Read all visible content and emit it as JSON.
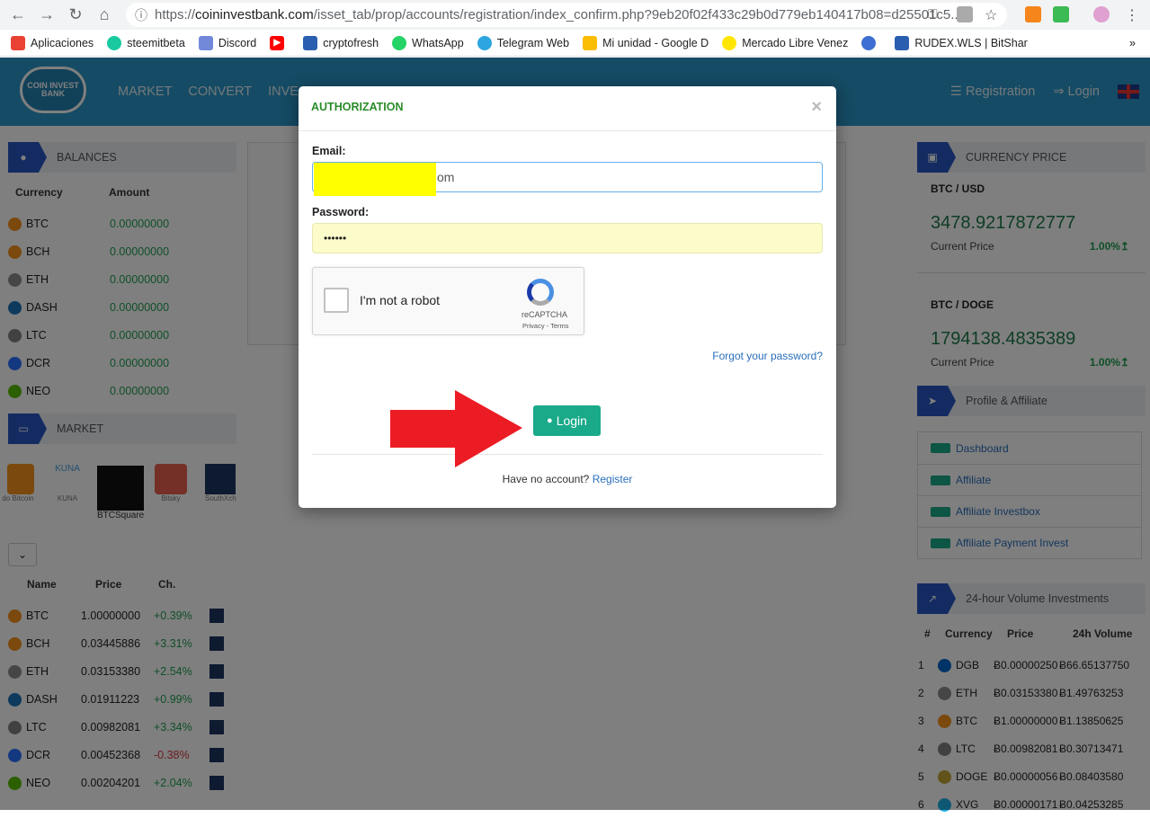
{
  "browser": {
    "url_prefix": "https://",
    "url_host": "coininvestbank.com",
    "url_path": "/isset_tab/prop/accounts/registration/index_confirm.php?9eb20f02f433c29b0d779eb140417b08=d25501c5...",
    "bookmarks": [
      "Aplicaciones",
      "steemitbeta",
      "Discord",
      "",
      "cryptofresh",
      "WhatsApp",
      "Telegram Web",
      "Mi unidad - Google D",
      "Mercado Libre Venez",
      "",
      "RUDEX.WLS | BitShar"
    ],
    "more": "»"
  },
  "header": {
    "logo_text": "COIN INVEST BANK",
    "nav": [
      "MARKET",
      "CONVERT",
      "INVE"
    ],
    "registration": "Registration",
    "login": "Login"
  },
  "balances": {
    "title": "BALANCES",
    "col_currency": "Currency",
    "col_amount": "Amount",
    "rows": [
      {
        "sym": "BTC",
        "amt": "0.00000000"
      },
      {
        "sym": "BCH",
        "amt": "0.00000000"
      },
      {
        "sym": "ETH",
        "amt": "0.00000000"
      },
      {
        "sym": "DASH",
        "amt": "0.00000000"
      },
      {
        "sym": "LTC",
        "amt": "0.00000000"
      },
      {
        "sym": "DCR",
        "amt": "0.00000000"
      },
      {
        "sym": "NEO",
        "amt": "0.00000000"
      }
    ]
  },
  "market": {
    "title": "MARKET",
    "logos": [
      "do Bitcoin",
      "KUNA",
      "BTCSquare",
      "Bitsky",
      "SouthXch"
    ],
    "col_name": "Name",
    "col_price": "Price",
    "col_ch": "Ch.",
    "rows": [
      {
        "sym": "BTC",
        "price": "1.00000000",
        "ch": "+0.39%",
        "up": true
      },
      {
        "sym": "BCH",
        "price": "0.03445886",
        "ch": "+3.31%",
        "up": true
      },
      {
        "sym": "ETH",
        "price": "0.03153380",
        "ch": "+2.54%",
        "up": true
      },
      {
        "sym": "DASH",
        "price": "0.01911223",
        "ch": "+0.99%",
        "up": true
      },
      {
        "sym": "LTC",
        "price": "0.00982081",
        "ch": "+3.34%",
        "up": true
      },
      {
        "sym": "DCR",
        "price": "0.00452368",
        "ch": "-0.38%",
        "up": false
      },
      {
        "sym": "NEO",
        "price": "0.00204201",
        "ch": "+2.04%",
        "up": true
      }
    ]
  },
  "currency_price": {
    "title": "CURRENCY PRICE",
    "pairs": [
      {
        "pair": "BTC / USD",
        "value": "3478.9217872777",
        "label": "Current Price",
        "change": "1.00%↥"
      },
      {
        "pair": "BTC / DOGE",
        "value": "1794138.4835389",
        "label": "Current Price",
        "change": "1.00%↥"
      }
    ]
  },
  "profile": {
    "title": "Profile & Affiliate",
    "links": [
      "Dashboard",
      "Affiliate",
      "Affiliate Investbox",
      "Affiliate Payment Invest"
    ]
  },
  "volume": {
    "title": "24-hour Volume Investments",
    "cols": [
      "#",
      "Currency",
      "Price",
      "24h Volume"
    ],
    "rows": [
      {
        "n": "1",
        "sym": "DGB",
        "price": "Ƀ0.00000250",
        "vol": "Ƀ66.65137750"
      },
      {
        "n": "2",
        "sym": "ETH",
        "price": "Ƀ0.03153380",
        "vol": "Ƀ1.49763253"
      },
      {
        "n": "3",
        "sym": "BTC",
        "price": "Ƀ1.00000000",
        "vol": "Ƀ1.13850625"
      },
      {
        "n": "4",
        "sym": "LTC",
        "price": "Ƀ0.00982081",
        "vol": "Ƀ0.30713471"
      },
      {
        "n": "5",
        "sym": "DOGE",
        "price": "Ƀ0.00000056",
        "vol": "Ƀ0.08403580"
      },
      {
        "n": "6",
        "sym": "XVG",
        "price": "Ƀ0.00000171",
        "vol": "Ƀ0.04253285"
      }
    ]
  },
  "modal": {
    "title": "AUTHORIZATION",
    "close": "×",
    "email_label": "Email:",
    "email_value": "om",
    "password_label": "Password:",
    "password_value": "••••••",
    "captcha_text": "I'm not a robot",
    "captcha_brand": "reCAPTCHA",
    "captcha_links": "Privacy - Terms",
    "forgot": "Forgot your password?",
    "login_button": "Login",
    "no_account": "Have no account?",
    "register": "Register"
  }
}
